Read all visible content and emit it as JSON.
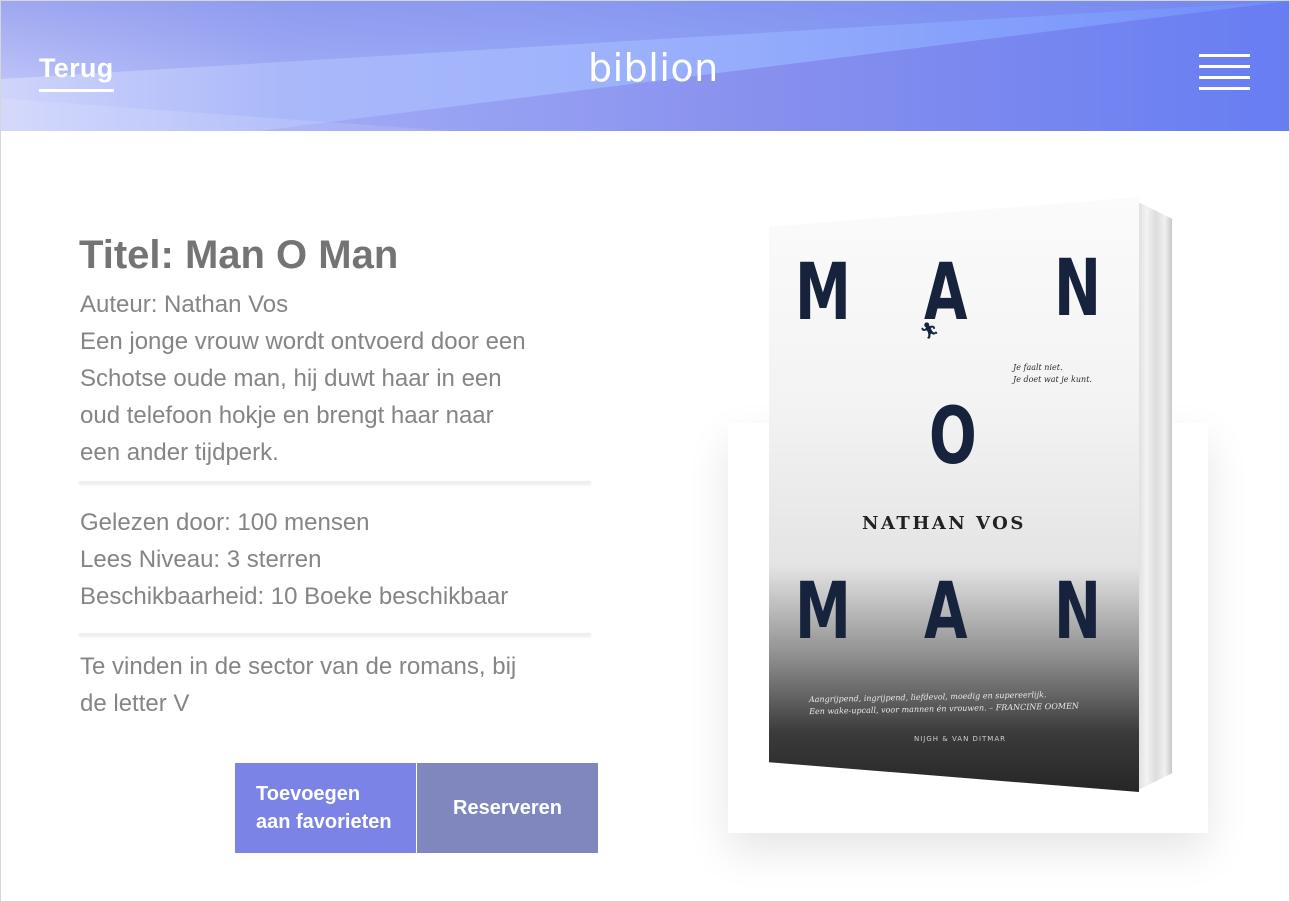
{
  "header": {
    "back_label": "Terug",
    "logo_text": "biblion",
    "menu_icon": "hamburger-menu-icon"
  },
  "book": {
    "title": "Titel: Man O Man",
    "author": "Auteur: Nathan Vos",
    "description": [
      "Een jonge vrouw wordt ontvoerd door een",
      "Schotse oude man, hij duwt haar in een",
      "oud telefoon hokje en brengt haar naar",
      "een ander tijdperk."
    ],
    "stats": {
      "read_by": "Gelezen door: 100 mensen",
      "level": "Lees Niveau: 3 sterren",
      "availability": "Beschikbaarheid: 10 Boeke beschikbaar"
    },
    "location": [
      "Te vinden in de sector van de romans, bij",
      "de letter V"
    ]
  },
  "actions": {
    "favorite_line1": "Toevoegen",
    "favorite_line2": "aan favorieten",
    "reserve": "Reserveren"
  },
  "cover": {
    "top_word": [
      "M",
      "A",
      "N"
    ],
    "middle_word": "O",
    "bottom_word": [
      "M",
      "A",
      "N"
    ],
    "author": "NATHAN VOS",
    "quote_line1": "Je faalt niet.",
    "quote_line2": "Je doet wat je kunt.",
    "blurb_line1": "Aangrijpend, ingrijpend, liefdevol, moedig en supereerlijk.",
    "blurb_line2": "Een wake-upcall, voor mannen én vrouwen. – FRANCINE OOMEN",
    "publisher": "NIJGH & VAN DITMAR"
  },
  "colors": {
    "header_start": "#cfd4fb",
    "header_end": "#6f8cf8",
    "favorite_button": "#7b84e6",
    "reserve_button": "#8087bf",
    "title_text": "#747474",
    "body_text": "#858585"
  }
}
